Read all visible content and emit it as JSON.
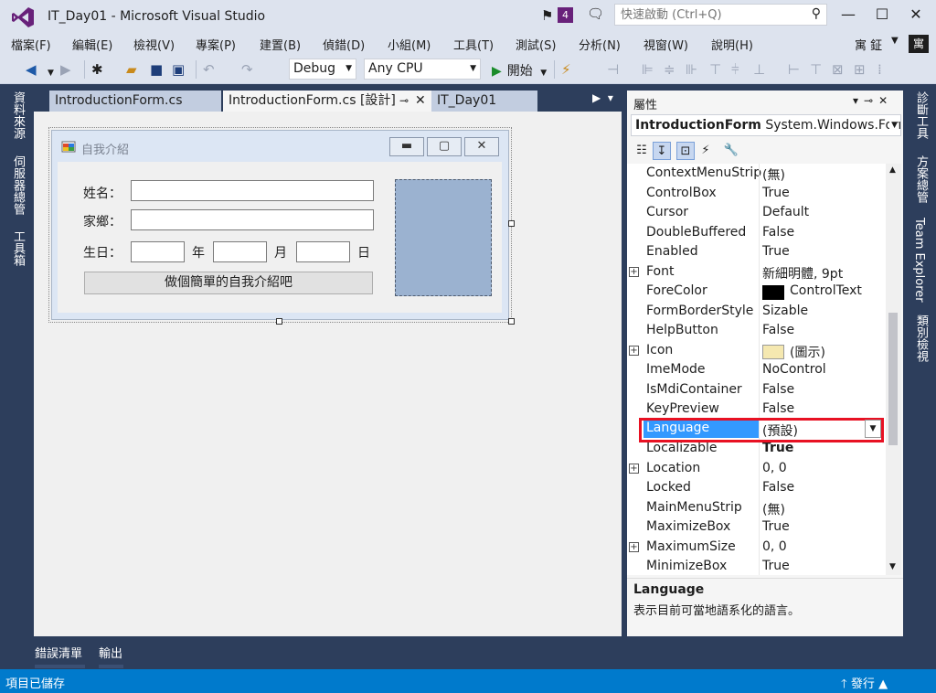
{
  "window": {
    "title": "IT_Day01 - Microsoft Visual Studio",
    "notification_count": "4",
    "quick_launch_placeholder": "快速啟動 (Ctrl+Q)",
    "controls": [
      "—",
      "☐",
      "✕"
    ]
  },
  "menu": {
    "items": [
      "檔案(F)",
      "編輯(E)",
      "檢視(V)",
      "專案(P)",
      "建置(B)",
      "偵錯(D)",
      "小組(M)",
      "工具(T)",
      "測試(S)",
      "分析(N)",
      "視窗(W)",
      "說明(H)"
    ],
    "user_name": "寓 鉦",
    "user_badge": "寓"
  },
  "toolbar": {
    "config": "Debug",
    "platform": "Any CPU",
    "start_label": "開始"
  },
  "left_rail": [
    "資料來源",
    "伺服器總管",
    "工具箱"
  ],
  "right_rail": [
    "診斷工具",
    "方案總管",
    "Team Explorer",
    "類別檢視"
  ],
  "doc_tabs": [
    {
      "label": "IntroductionForm.cs"
    },
    {
      "label": "IntroductionForm.cs [設計]"
    },
    {
      "label": "IT_Day01"
    }
  ],
  "form": {
    "title": "自我介紹",
    "name_label": "姓名：",
    "hometown_label": "家鄉：",
    "birthday_label": "生日：",
    "year_label": "年",
    "month_label": "月",
    "day_label": "日",
    "button_label": "做個簡單的自我介紹吧"
  },
  "properties": {
    "title": "屬性",
    "object_name": "IntroductionForm",
    "object_type": "System.Windows.Forms",
    "rows": [
      {
        "name": "ContextMenuStrip",
        "value": "(無)"
      },
      {
        "name": "ControlBox",
        "value": "True"
      },
      {
        "name": "Cursor",
        "value": "Default"
      },
      {
        "name": "DoubleBuffered",
        "value": "False"
      },
      {
        "name": "Enabled",
        "value": "True"
      },
      {
        "name": "Font",
        "value": "新細明體, 9pt",
        "expandable": true
      },
      {
        "name": "ForeColor",
        "value": "ControlText",
        "swatch": "#000000"
      },
      {
        "name": "FormBorderStyle",
        "value": "Sizable"
      },
      {
        "name": "HelpButton",
        "value": "False"
      },
      {
        "name": "Icon",
        "value": "(圖示)",
        "expandable": true
      },
      {
        "name": "ImeMode",
        "value": "NoControl"
      },
      {
        "name": "IsMdiContainer",
        "value": "False"
      },
      {
        "name": "KeyPreview",
        "value": "False"
      },
      {
        "name": "Language",
        "value": "(預設)",
        "selected": true
      },
      {
        "name": "Localizable",
        "value": "True",
        "bold": true
      },
      {
        "name": "Location",
        "value": "0, 0",
        "expandable": true
      },
      {
        "name": "Locked",
        "value": "False"
      },
      {
        "name": "MainMenuStrip",
        "value": "(無)"
      },
      {
        "name": "MaximizeBox",
        "value": "True"
      },
      {
        "name": "MaximumSize",
        "value": "0, 0",
        "expandable": true
      },
      {
        "name": "MinimizeBox",
        "value": "True"
      }
    ],
    "description_title": "Language",
    "description_text": "表示目前可當地語系化的語言。"
  },
  "bottom_tabs": [
    "錯誤清單",
    "輸出"
  ],
  "status": {
    "text": "項目已儲存",
    "publish": "發行"
  },
  "colors": {
    "accent": "#68217a",
    "status_bar": "#007acc",
    "chrome": "#2d3e5c",
    "highlight": "#e81123",
    "selection": "#3399ff"
  }
}
